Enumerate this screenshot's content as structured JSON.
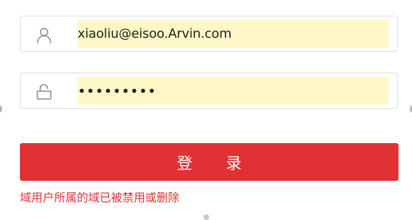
{
  "login_form": {
    "username": {
      "icon": "user-icon",
      "value": "xiaoliu@eisoo.Arvin.com"
    },
    "password": {
      "icon": "lock-icon",
      "value": "•••••••••"
    },
    "submit_label": "登 录",
    "error_message": "域用户所属的域已被禁用或删除"
  },
  "colors": {
    "accent": "#e03134",
    "autofill_background": "#fdf8c6",
    "border": "#dedede"
  }
}
